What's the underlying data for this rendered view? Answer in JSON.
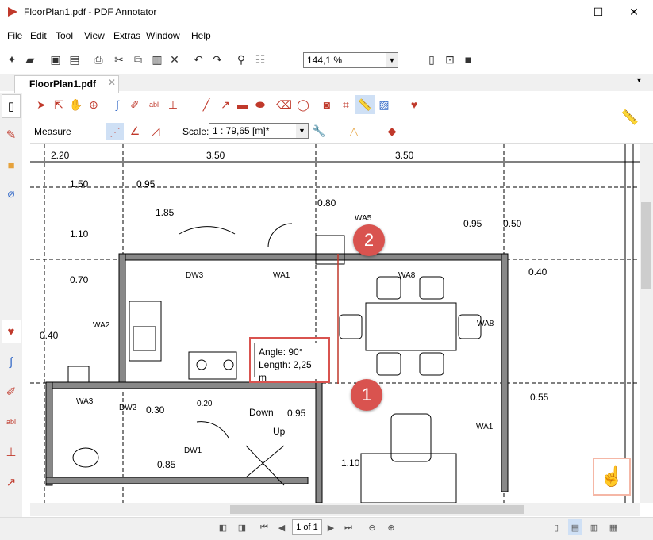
{
  "window": {
    "title": "FloorPlan1.pdf - PDF Annotator",
    "minimize": "—",
    "maximize": "☐",
    "close": "✕"
  },
  "menu": [
    "File",
    "Edit",
    "Tool",
    "View",
    "Extras",
    "Window",
    "Help"
  ],
  "toolbar": {
    "zoom": "144,1 %"
  },
  "tab": {
    "label": "FloorPlan1.pdf"
  },
  "measure": {
    "label": "Measure",
    "scale_label": "Scale:",
    "scale_value": "1 : 79,65 [m]*"
  },
  "tooltip": {
    "angle": "Angle: 90°",
    "length": "Length: 2,25 m"
  },
  "badges": [
    "1",
    "2"
  ],
  "status": {
    "page": "1 of 1"
  },
  "plan_labels": {
    "dims": [
      "2.20",
      "3.50",
      "3.50",
      "1.50",
      "0.95",
      "1.85",
      "0.80",
      "0.95",
      "0.50",
      "1.10",
      "0.70",
      "0.40",
      "0.40",
      "0.55",
      "0.30",
      "0.20",
      "0.95",
      "0.85",
      "1.10"
    ],
    "tags": [
      "WA5",
      "DW3",
      "WA1",
      "WA8",
      "WA8",
      "WA2",
      "WA3",
      "DW2",
      "DW1",
      "WA1"
    ],
    "text": [
      "Down",
      "Up"
    ]
  },
  "colors": {
    "accent": "#d9534f",
    "icon_red": "#c0392b"
  }
}
